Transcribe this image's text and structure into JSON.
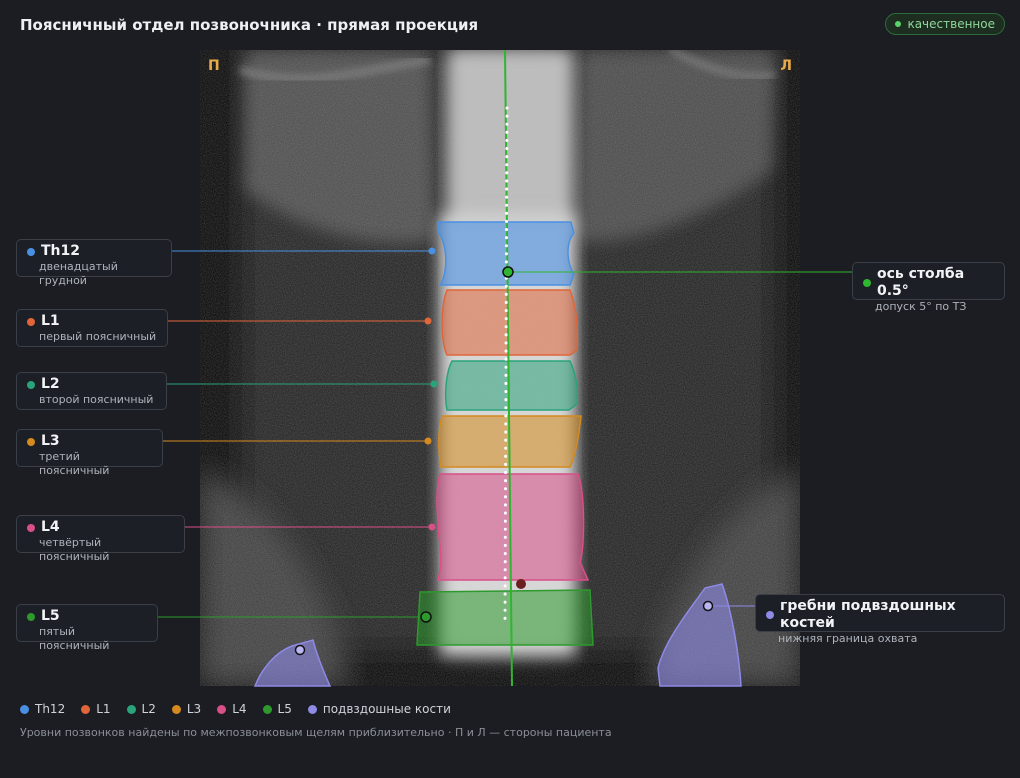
{
  "header": {
    "title": "Поясничный отдел позвоночника · прямая проекция",
    "quality_badge": "качественное",
    "quality_color": "#5bd36b"
  },
  "viewer": {
    "left_marker": "П",
    "right_marker": "Л"
  },
  "vertebrae": [
    {
      "id": "th12",
      "label": "Th12",
      "sub": "двенадцатый грудной",
      "color": "#4a90e2"
    },
    {
      "id": "l1",
      "label": "L1",
      "sub": "первый поясничный",
      "color": "#e0663a"
    },
    {
      "id": "l2",
      "label": "L2",
      "sub": "второй поясничный",
      "color": "#2aa37a"
    },
    {
      "id": "l3",
      "label": "L3",
      "sub": "третий поясничный",
      "color": "#d48a1e"
    },
    {
      "id": "l4",
      "label": "L4",
      "sub": "четвёртый поясничный",
      "color": "#d94f88"
    },
    {
      "id": "l5",
      "label": "L5",
      "sub": "пятый поясничный",
      "color": "#2e9a2e"
    }
  ],
  "axis": {
    "label": "ось столба 0.5°",
    "sub": "допуск 5° по ТЗ",
    "color": "#2fb52f"
  },
  "iliac": {
    "label": "гребни подвздошных костей",
    "sub": "нижняя граница охвата",
    "color": "#8e8ae6"
  },
  "legend": [
    {
      "label": "Th12",
      "color": "#4a90e2"
    },
    {
      "label": "L1",
      "color": "#e0663a"
    },
    {
      "label": "L2",
      "color": "#2aa37a"
    },
    {
      "label": "L3",
      "color": "#d48a1e"
    },
    {
      "label": "L4",
      "color": "#d94f88"
    },
    {
      "label": "L5",
      "color": "#2e9a2e"
    },
    {
      "label": "подвздошные кости",
      "color": "#8e8ae6"
    }
  ],
  "footnote": "Уровни позвонков найдены по межпозвонковым щелям приблизительно · П и Л — стороны пациента"
}
